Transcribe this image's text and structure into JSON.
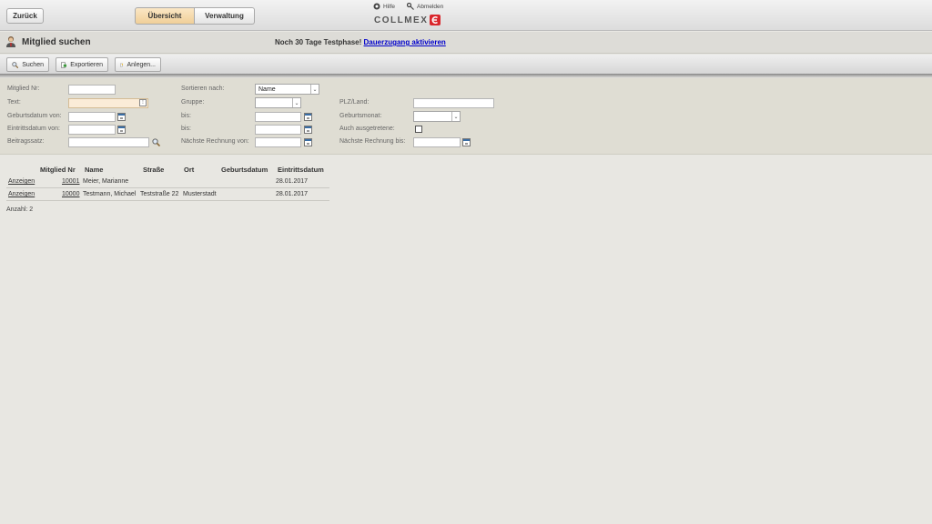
{
  "header": {
    "back_label": "Zurück",
    "tabs": [
      {
        "label": "Übersicht",
        "active": true
      },
      {
        "label": "Verwaltung",
        "active": false
      }
    ],
    "help_label": "Hilfe",
    "logout_label": "Abmelden",
    "logo_text": "COLLMEX"
  },
  "titlebar": {
    "title": "Mitglied suchen",
    "trial_text": "Noch 30 Tage Testphase!",
    "trial_link": "Dauerzugang aktivieren"
  },
  "toolbar": {
    "search_label": "Suchen",
    "export_label": "Exportieren",
    "new_label": "Anlegen..."
  },
  "filters": {
    "member_no": {
      "label": "Mitglied Nr:",
      "value": ""
    },
    "text": {
      "label": "Text:",
      "value": ""
    },
    "birth_from": {
      "label": "Geburtsdatum von:",
      "value": ""
    },
    "entry_from": {
      "label": "Eintrittsdatum von:",
      "value": ""
    },
    "fee": {
      "label": "Beitragssatz:",
      "value": ""
    },
    "sort_by": {
      "label": "Sortieren nach:",
      "value": "Name"
    },
    "group": {
      "label": "Gruppe:",
      "value": ""
    },
    "birth_to": {
      "label": "bis:",
      "value": ""
    },
    "entry_to": {
      "label": "bis:",
      "value": ""
    },
    "next_invoice_from": {
      "label": "Nächste Rechnung von:",
      "value": ""
    },
    "zip_country": {
      "label": "PLZ/Land:",
      "value": ""
    },
    "birth_month": {
      "label": "Geburtsmonat:",
      "value": ""
    },
    "include_left": {
      "label": "Auch ausgetretene:",
      "checked": false
    },
    "next_invoice_to": {
      "label": "Nächste Rechnung bis:",
      "value": ""
    }
  },
  "table": {
    "columns": [
      "Mitglied Nr",
      "Name",
      "Straße",
      "Ort",
      "Geburtsdatum",
      "Eintrittsdatum"
    ],
    "rows": [
      {
        "action": "Anzeigen",
        "member_no": "10001",
        "name": "Meier, Marianne",
        "street": "",
        "city": "",
        "birth": "",
        "entry": "28.01.2017"
      },
      {
        "action": "Anzeigen",
        "member_no": "10000",
        "name": "Testmann, Michael",
        "street": "Teststraße 22",
        "city": "Musterstadt",
        "birth": "",
        "entry": "28.01.2017"
      }
    ],
    "count_text": "Anzahl: 2"
  },
  "colors": {
    "accent_tab": "#f0cf98",
    "link": "#0000cc",
    "logo_red": "#d9262c"
  }
}
